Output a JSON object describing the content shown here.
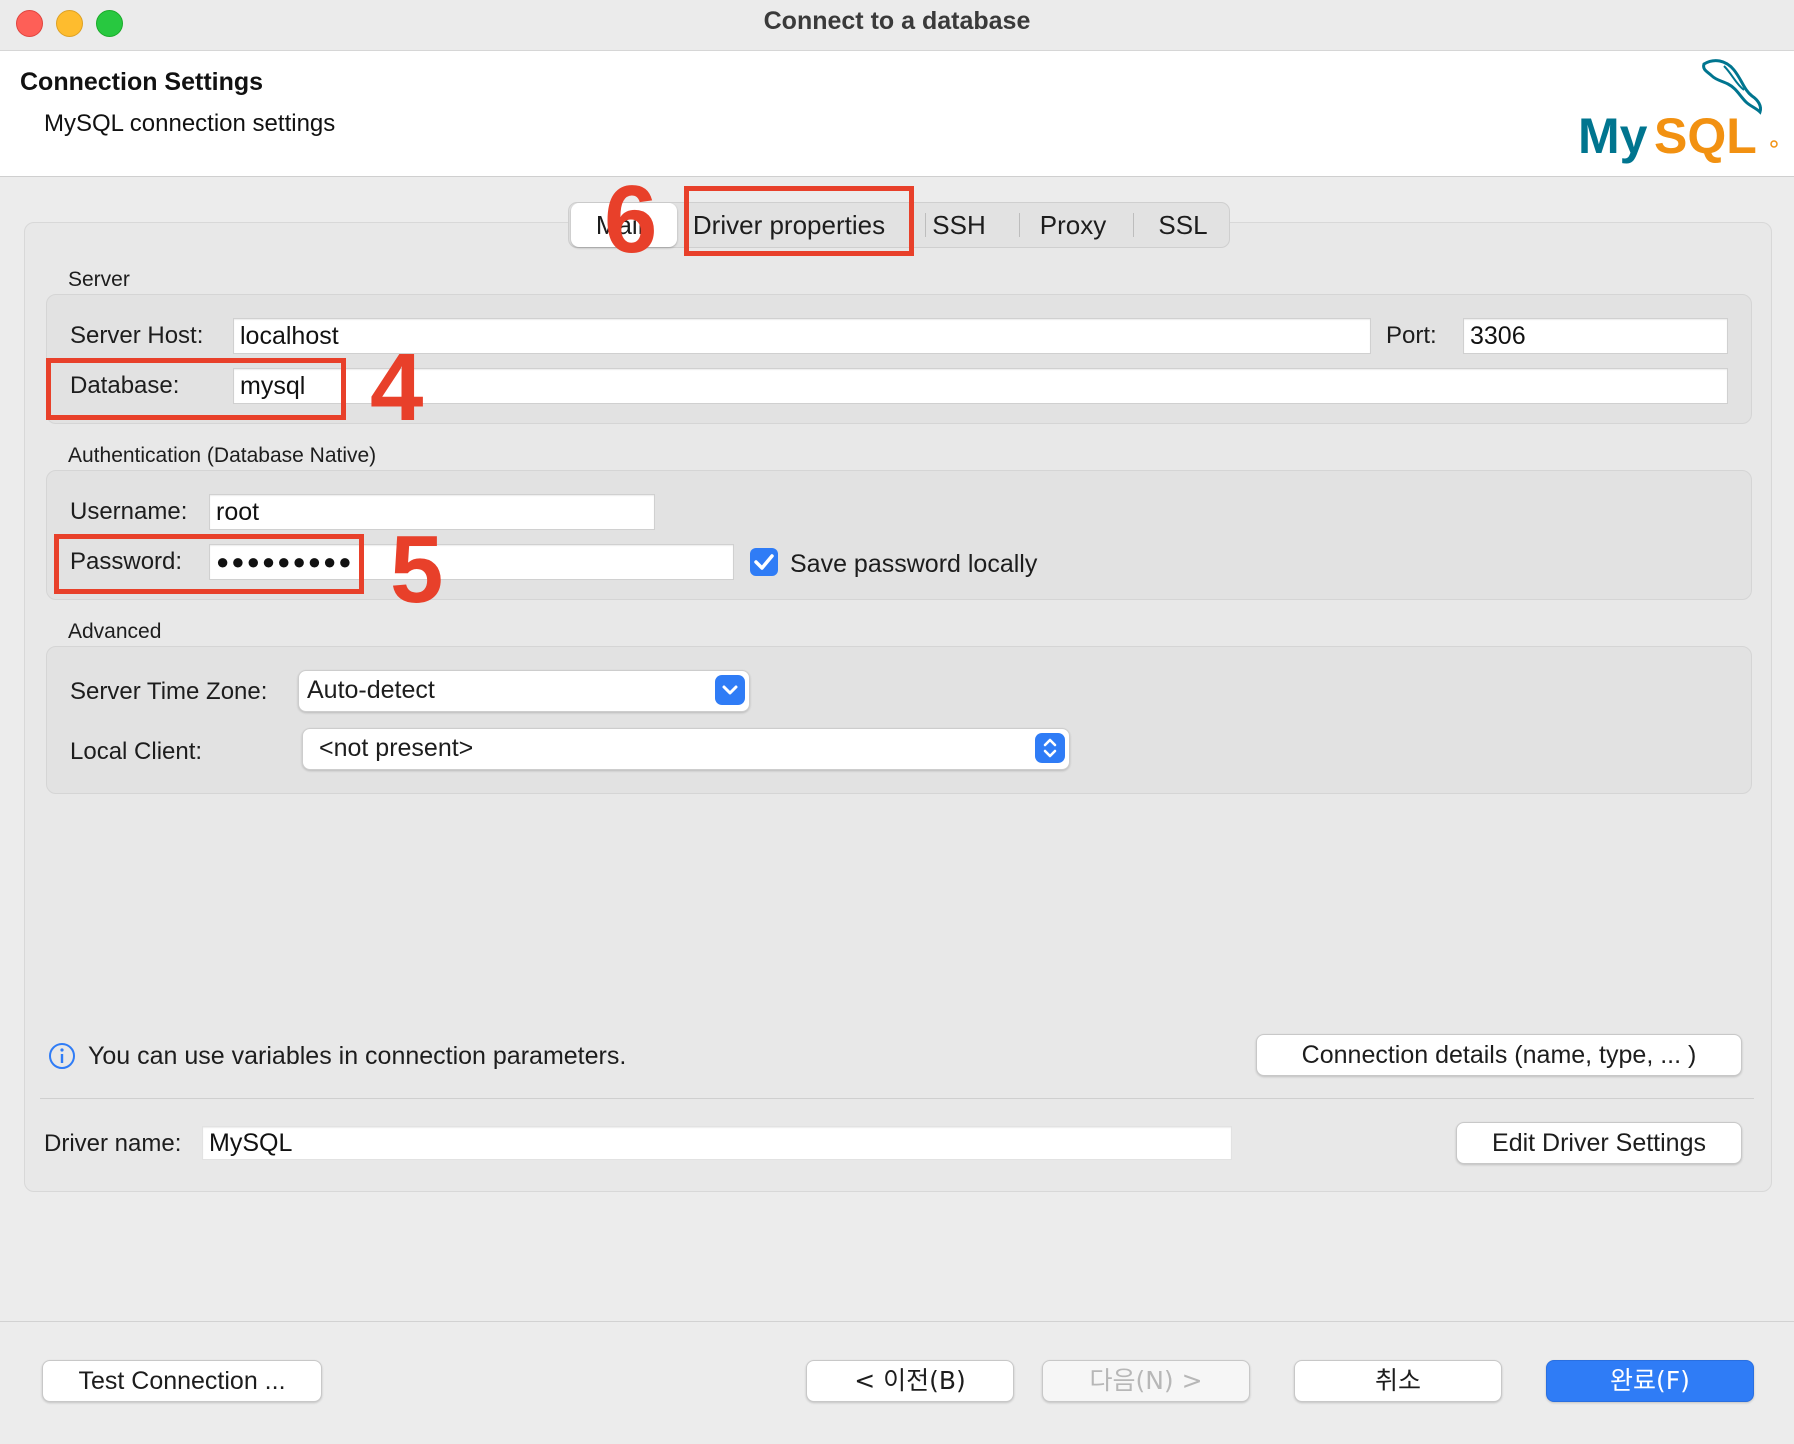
{
  "window": {
    "title": "Connect to a database"
  },
  "header": {
    "title": "Connection Settings",
    "subtitle": "MySQL connection settings",
    "logo_text": "MySQL"
  },
  "tabs": [
    {
      "label": "Main",
      "selected": true
    },
    {
      "label": "Driver properties"
    },
    {
      "label": "SSH"
    },
    {
      "label": "Proxy"
    },
    {
      "label": "SSL"
    }
  ],
  "server": {
    "group_label": "Server",
    "host_label": "Server Host:",
    "host_value": "localhost",
    "port_label": "Port:",
    "port_value": "3306",
    "database_label": "Database:",
    "database_value": "mysql"
  },
  "auth": {
    "group_label": "Authentication (Database Native)",
    "username_label": "Username:",
    "username_value": "root",
    "password_label": "Password:",
    "password_value": "●●●●●●●●●",
    "save_password_label": "Save password locally",
    "save_password_checked": true
  },
  "advanced": {
    "group_label": "Advanced",
    "timezone_label": "Server Time Zone:",
    "timezone_value": "Auto-detect",
    "local_client_label": "Local Client:",
    "local_client_value": "<not present>"
  },
  "info": {
    "text": "You can use variables in connection parameters.",
    "details_button": "Connection details (name, type, ... )"
  },
  "driver": {
    "name_label": "Driver name:",
    "name_value": "MySQL",
    "edit_button": "Edit Driver Settings"
  },
  "annotations": {
    "four": "4",
    "five": "5",
    "six": "6"
  },
  "footer": {
    "test_button": "Test Connection ...",
    "back_button": "< 이전(B)",
    "next_button": "다음(N) >",
    "cancel_button": "취소",
    "finish_button": "완료(F)"
  },
  "colors": {
    "accent": "#2f7cf6",
    "annotation": "#e8402a",
    "mysql_teal": "#00758f",
    "mysql_orange": "#f29111"
  }
}
